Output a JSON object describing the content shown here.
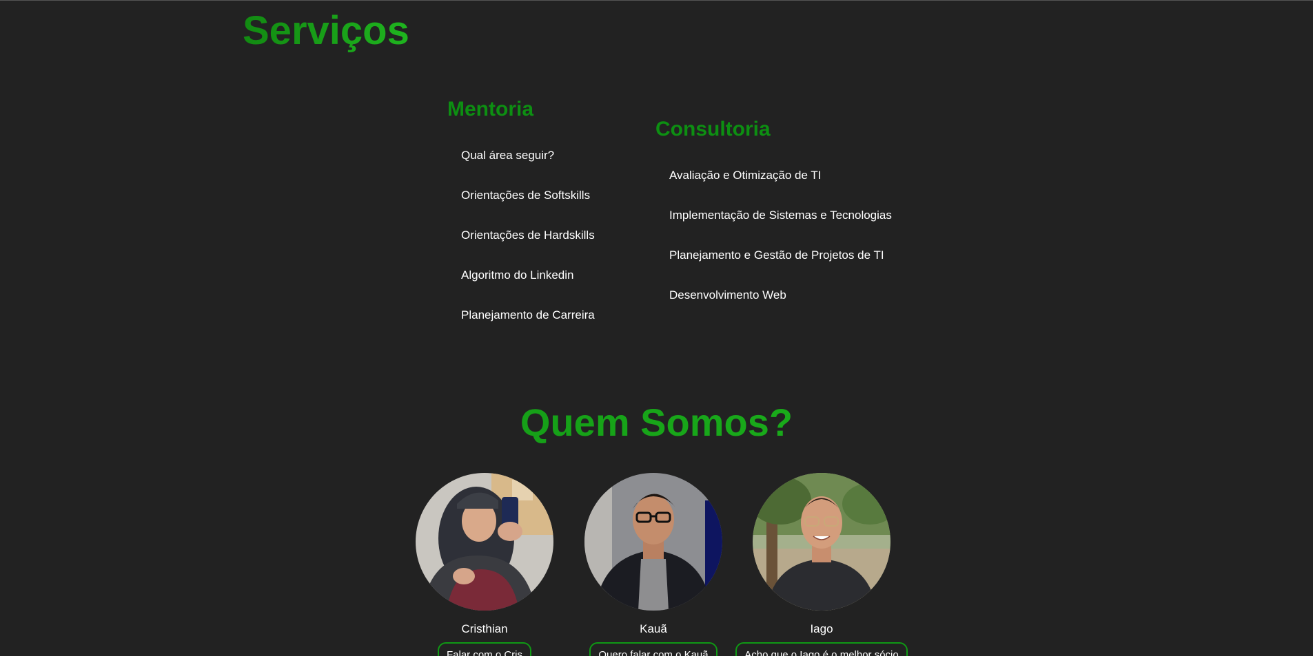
{
  "services": {
    "title": "Serviços",
    "mentoria": {
      "heading": "Mentoria",
      "items": [
        "Qual área seguir?",
        "Orientações de Softskills",
        "Orientações de Hardskills",
        "Algoritmo do Linkedin",
        "Planejamento de Carreira"
      ]
    },
    "consultoria": {
      "heading": "Consultoria",
      "items": [
        "Avaliação e Otimização de TI",
        "Implementação de Sistemas e Tecnologias",
        "Planejamento e Gestão de Projetos de TI",
        "Desenvolvimento Web"
      ]
    }
  },
  "about": {
    "title": "Quem Somos?",
    "members": [
      {
        "name": "Cristhian",
        "button": "Falar com o Cris"
      },
      {
        "name": "Kauã",
        "button": "Quero falar com o Kauã"
      },
      {
        "name": "Iago",
        "button": "Acho que o Iago é o melhor sócio"
      }
    ]
  },
  "colors": {
    "background": "#222222",
    "accent_green": "#0f9a14",
    "text": "#ffffff"
  }
}
